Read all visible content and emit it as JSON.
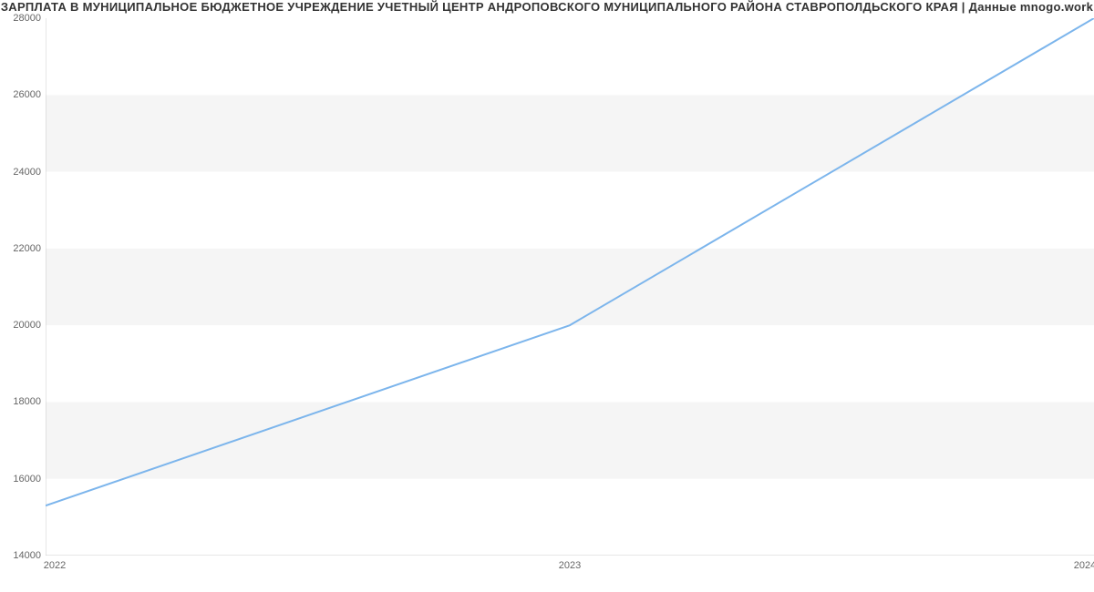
{
  "chart_data": {
    "type": "line",
    "title": "ЗАРПЛАТА В МУНИЦИПАЛЬНОЕ БЮДЖЕТНОЕ УЧРЕЖДЕНИЕ УЧЕТНЫЙ ЦЕНТР АНДРОПОВСКОГО МУНИЦИПАЛЬНОГО РАЙОНА СТАВРОПОЛДЬСКОГО КРАЯ | Данные mnogo.work",
    "x": [
      2022,
      2023,
      2024
    ],
    "values": [
      15300,
      20000,
      28000
    ],
    "xticks": [
      2022,
      2023,
      2024
    ],
    "yticks": [
      14000,
      16000,
      18000,
      20000,
      22000,
      24000,
      26000,
      28000
    ],
    "ylim": [
      14000,
      28000
    ],
    "xlim": [
      2022,
      2024
    ],
    "line_color": "#7cb5ec"
  }
}
